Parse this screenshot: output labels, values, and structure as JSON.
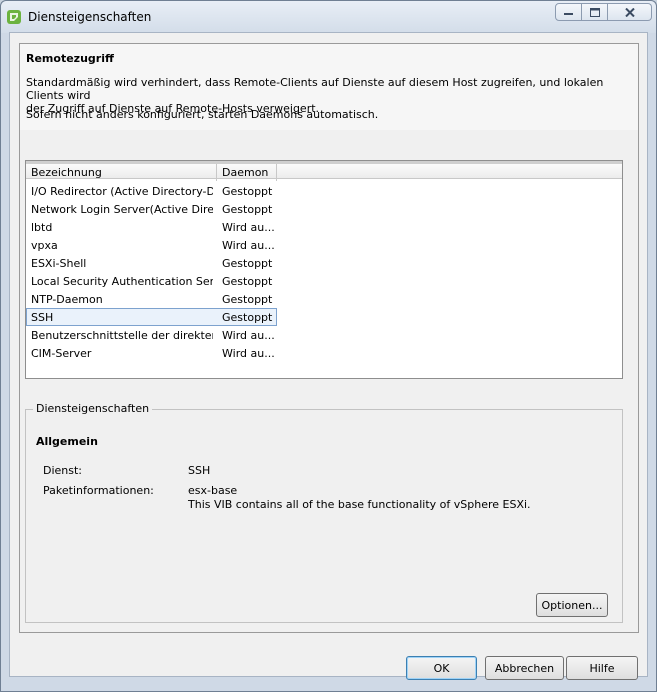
{
  "window": {
    "title": "Diensteigenschaften"
  },
  "header": {
    "section_title": "Remotezugriff",
    "description_line1": "Standardmäßig wird verhindert, dass Remote-Clients auf Dienste auf diesem Host zugreifen, und lokalen Clients wird",
    "description_line2": "der Zugriff auf Dienste auf Remote-Hosts verweigert.",
    "description_daemon": "Sofern nicht anders konfiguriert, starten Daemons automatisch."
  },
  "services_table": {
    "columns": [
      "Bezeichnung",
      "Daemon"
    ],
    "rows": [
      {
        "name": "I/O Redirector (Active Directory-Di...",
        "daemon": "Gestoppt"
      },
      {
        "name": "Network Login Server(Active Direc...",
        "daemon": "Gestoppt"
      },
      {
        "name": "lbtd",
        "daemon": "Wird au..."
      },
      {
        "name": "vpxa",
        "daemon": "Wird au..."
      },
      {
        "name": "ESXi-Shell",
        "daemon": "Gestoppt"
      },
      {
        "name": "Local Security Authentication Serv...",
        "daemon": "Gestoppt"
      },
      {
        "name": "NTP-Daemon",
        "daemon": "Gestoppt"
      },
      {
        "name": "SSH",
        "daemon": "Gestoppt",
        "selected": true
      },
      {
        "name": "Benutzerschnittstelle der direkten ...",
        "daemon": "Wird au..."
      },
      {
        "name": "CIM-Server",
        "daemon": "Wird au..."
      }
    ]
  },
  "properties": {
    "group_label": "Diensteigenschaften",
    "heading": "Allgemein",
    "service_label": "Dienst:",
    "service_value": "SSH",
    "package_label": "Paketinformationen:",
    "package_name": "esx-base",
    "package_description": "This VIB contains all of the base functionality of vSphere ESXi.",
    "options_button": "Optionen..."
  },
  "footer": {
    "ok_label": "OK",
    "cancel_label": "Abbrechen",
    "help_label": "Hilfe"
  },
  "colors": {
    "selection_border": "#7da2ce",
    "selection_fill": "#eaf2fb",
    "default_button_border": "#3c7fb1"
  }
}
